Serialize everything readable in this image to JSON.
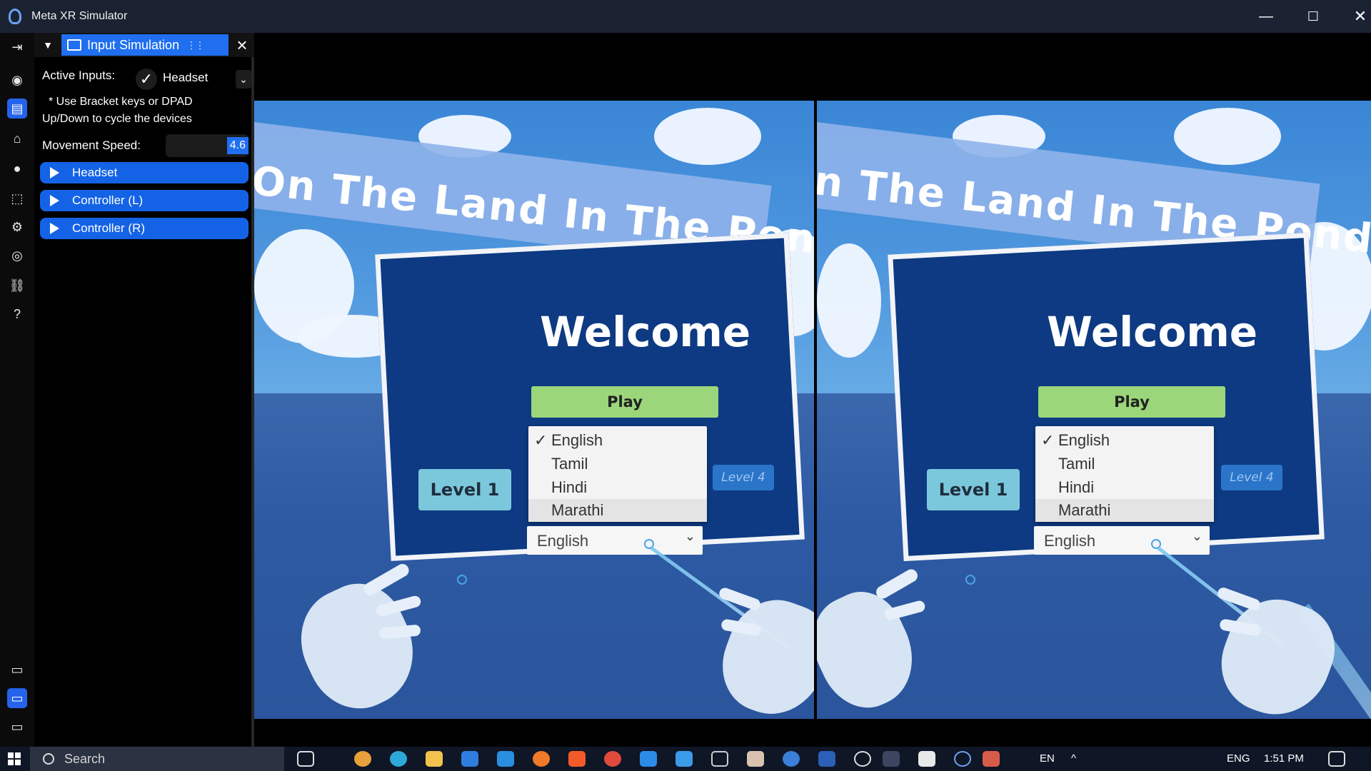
{
  "window": {
    "title": "Meta XR Simulator",
    "controls": {
      "minimize": "—",
      "maximize": "☐",
      "close": "✕"
    }
  },
  "rail": {
    "icons": [
      "exit-icon",
      "headset-icon",
      "input-simulation-icon",
      "room-icon",
      "record-icon",
      "graph-icon",
      "settings-icon",
      "vr-headset-icon",
      "link-icon",
      "help-icon",
      "gamepad-icon",
      "controller-active-icon",
      "controller-icon"
    ]
  },
  "panel": {
    "tab_label": "Input Simulation",
    "active_inputs_label": "Active Inputs:",
    "active_input_value": "Headset",
    "hint_line1": "* Use Bracket keys or DPAD",
    "hint_line2": "Up/Down to cycle the devices",
    "movement_speed_label": "Movement Speed:",
    "movement_speed_value": "4.6",
    "sections": [
      "Headset",
      "Controller (L)",
      "Controller (R)"
    ]
  },
  "scene": {
    "banner": "On The Land In The Pond",
    "banner_right": "n The Land In The Pond",
    "welcome": "Welcome",
    "play": "Play",
    "level1": "Level 1",
    "level4": "Level 4",
    "languages": [
      "English",
      "Tamil",
      "Hindi",
      "Marathi"
    ],
    "selected_language": "English",
    "colors": {
      "board": "#0d3a82",
      "play": "#9bd67a",
      "level": "#7bc7db",
      "sky": "#4f97de"
    }
  },
  "taskbar": {
    "search_placeholder": "Search",
    "language_short": "EN",
    "language": "ENG",
    "time": "1:51 PM"
  }
}
